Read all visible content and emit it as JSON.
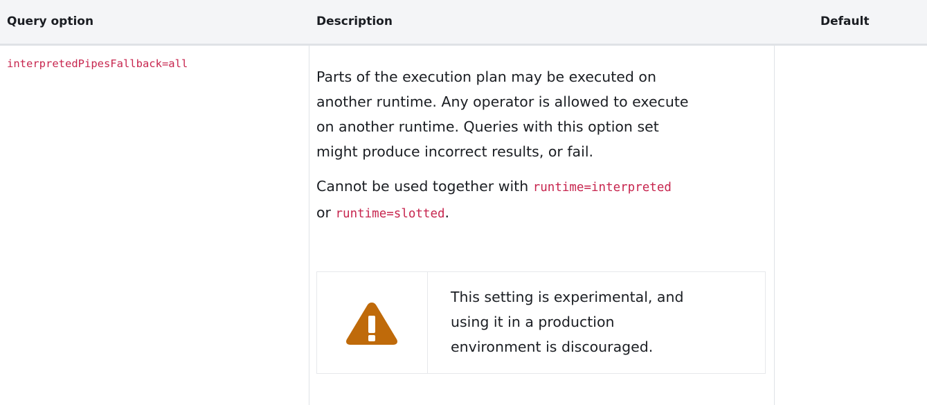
{
  "table": {
    "headers": {
      "option": "Query option",
      "description": "Description",
      "default": "Default"
    },
    "row": {
      "option": "interpretedPipesFallback=all",
      "description": {
        "paragraph1_lines": [
          "Parts of the execution plan may be executed on",
          "another runtime. Any operator is allowed to execute",
          "on another runtime. Queries with this option set",
          "might produce incorrect results, or fail."
        ],
        "paragraph2": {
          "prefix": "Cannot be used together with ",
          "code1": "runtime=interpreted",
          "middle": "or ",
          "code2": "runtime=slotted",
          "suffix": "."
        },
        "warning": {
          "icon": "warning-icon",
          "lines": [
            "This setting is experimental, and",
            "using it in a production",
            "environment is discouraged."
          ]
        }
      },
      "default": ""
    }
  },
  "colors": {
    "code": "#c7254e",
    "warning_icon": "#bf6a0a",
    "header_bg": "#f4f5f7",
    "border": "#dfe2e6"
  }
}
